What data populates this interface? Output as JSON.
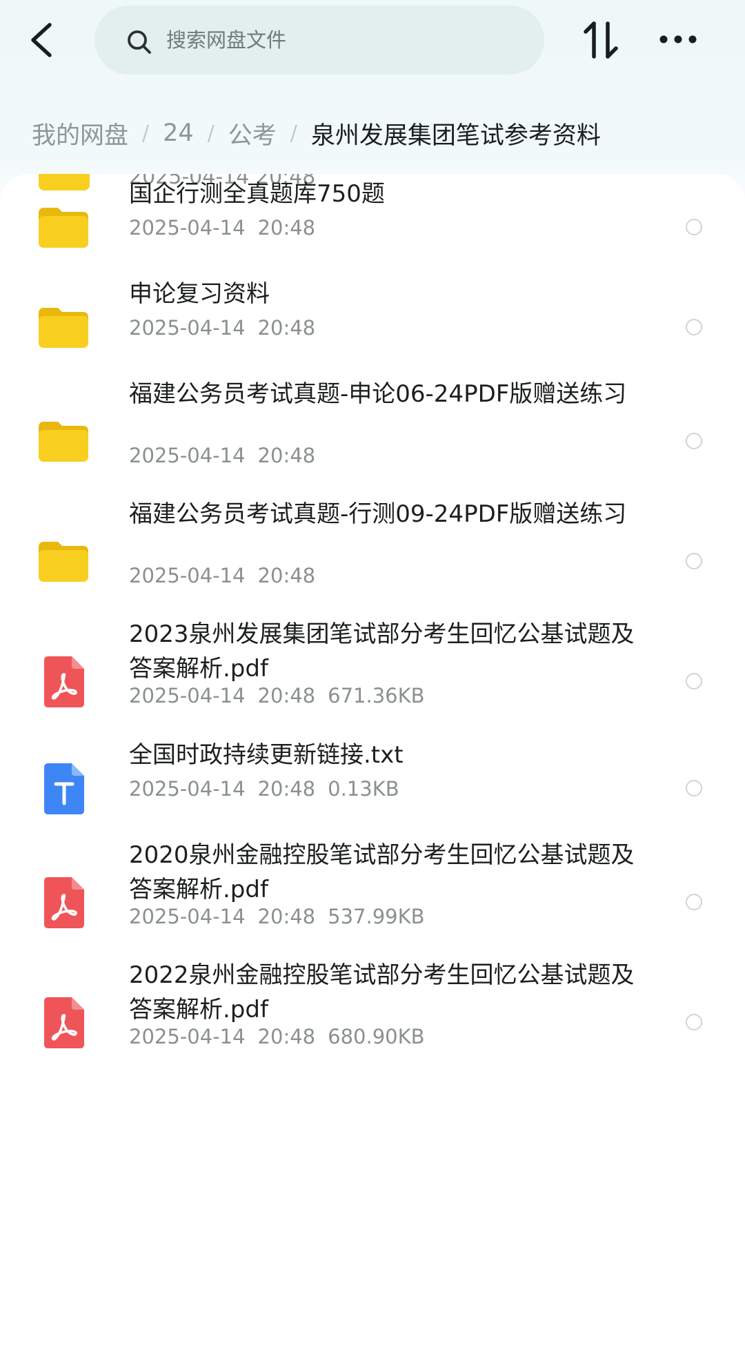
{
  "search": {
    "placeholder": "搜索网盘文件"
  },
  "icons": {
    "back": "chevron-left-icon",
    "search": "search-icon",
    "sort": "sort-icon",
    "more": "more-horizontal-icon"
  },
  "breadcrumb": {
    "items": [
      "我的网盘",
      "24",
      "公考"
    ],
    "separator": "/",
    "current": "泉州发展集团笔试参考资料"
  },
  "partial_item": {
    "modified": "2025-04-14  20:48"
  },
  "files": [
    {
      "type": "folder",
      "name": "国企行测全真题库750题",
      "date": "2025-04-14",
      "time": "20:48",
      "size": ""
    },
    {
      "type": "folder",
      "name": "申论复习资料",
      "date": "2025-04-14",
      "time": "20:48",
      "size": ""
    },
    {
      "type": "folder",
      "name": "福建公务员考试真题-申论06-24PDF版赠送练习",
      "date": "2025-04-14",
      "time": "20:48",
      "size": ""
    },
    {
      "type": "folder",
      "name": "福建公务员考试真题-行测09-24PDF版赠送练习",
      "date": "2025-04-14",
      "time": "20:48",
      "size": ""
    },
    {
      "type": "pdf",
      "name": "2023泉州发展集团笔试部分考生回忆公基试题及答案解析.pdf",
      "date": "2025-04-14",
      "time": "20:48",
      "size": "671.36KB"
    },
    {
      "type": "txt",
      "name": "全国时政持续更新链接.txt",
      "date": "2025-04-14",
      "time": "20:48",
      "size": "0.13KB"
    },
    {
      "type": "pdf",
      "name": "2020泉州金融控股笔试部分考生回忆公基试题及答案解析.pdf",
      "date": "2025-04-14",
      "time": "20:48",
      "size": "537.99KB"
    },
    {
      "type": "pdf",
      "name": "2022泉州金融控股笔试部分考生回忆公基试题及答案解析.pdf",
      "date": "2025-04-14",
      "time": "20:48",
      "size": "680.90KB"
    }
  ],
  "colors": {
    "folder": "#f8cf1f",
    "pdf": "#ef5458",
    "txt": "#3e86f5",
    "search_bg": "#e2efee"
  }
}
